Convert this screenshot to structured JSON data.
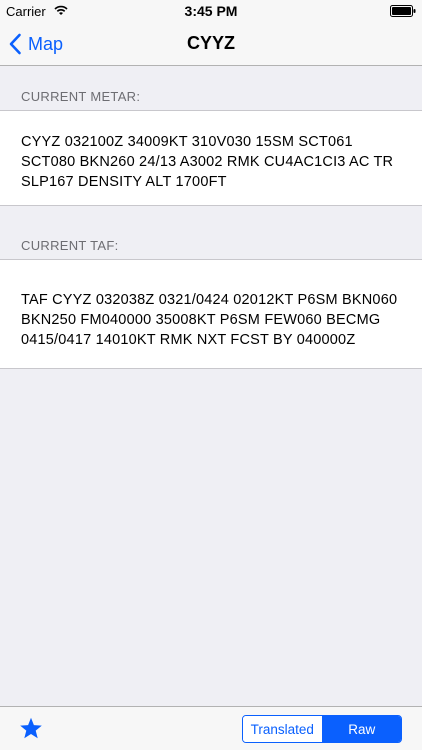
{
  "status_bar": {
    "carrier": "Carrier",
    "time": "3:45 PM"
  },
  "nav": {
    "back_label": "Map",
    "title": "CYYZ"
  },
  "metar": {
    "header": "CURRENT METAR:",
    "lines": [
      "CYYZ 032100Z 34009KT 310V030 15SM SCT061",
      "SCT080 BKN260 24/13 A3002 RMK CU4AC1CI3 AC TR",
      "SLP167 DENSITY ALT 1700FT"
    ]
  },
  "taf": {
    "header": "CURRENT TAF:",
    "lines": [
      "TAF CYYZ 032038Z 0321/0424 02012KT P6SM BKN060",
      "BKN250 FM040000 35008KT P6SM FEW060 BECMG",
      "0415/0417 14010KT RMK NXT FCST BY 040000Z"
    ]
  },
  "toolbar": {
    "favorite_icon": "star-icon",
    "segments": [
      "Translated",
      "Raw"
    ],
    "selected_segment": "Raw"
  },
  "colors": {
    "accent": "#0a60fe",
    "background": "#efeff4",
    "header_text": "#6d6d72"
  }
}
